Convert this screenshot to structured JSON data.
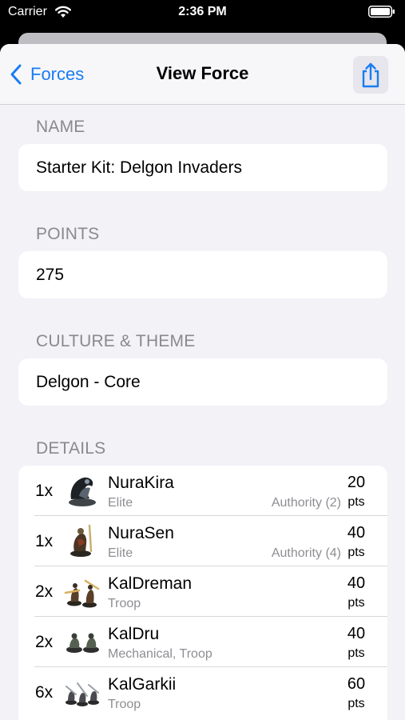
{
  "status_bar": {
    "carrier": "Carrier",
    "time": "2:36 PM"
  },
  "nav": {
    "back_label": "Forces",
    "title": "View Force",
    "share_icon": "share-icon"
  },
  "sections": {
    "name_header": "NAME",
    "name_value": "Starter Kit: Delgon Invaders",
    "points_header": "POINTS",
    "points_value": "275",
    "culture_header": "CULTURE & THEME",
    "culture_value": "Delgon - Core",
    "details_header": "DETAILS"
  },
  "units": [
    {
      "qty": "1x",
      "name": "NuraKira",
      "type": "Elite",
      "ability": "Authority (2)",
      "points": "20",
      "pts_label": "pts"
    },
    {
      "qty": "1x",
      "name": "NuraSen",
      "type": "Elite",
      "ability": "Authority (4)",
      "points": "40",
      "pts_label": "pts"
    },
    {
      "qty": "2x",
      "name": "KalDreman",
      "type": "Troop",
      "ability": "",
      "points": "40",
      "pts_label": "pts"
    },
    {
      "qty": "2x",
      "name": "KalDru",
      "type": "Mechanical, Troop",
      "ability": "",
      "points": "40",
      "pts_label": "pts"
    },
    {
      "qty": "6x",
      "name": "KalGarkii",
      "type": "Troop",
      "ability": "",
      "points": "60",
      "pts_label": "pts"
    }
  ],
  "colors": {
    "accent": "#1a7cf2",
    "background": "#f2f2f7",
    "secondary_text": "#8e8e93"
  }
}
